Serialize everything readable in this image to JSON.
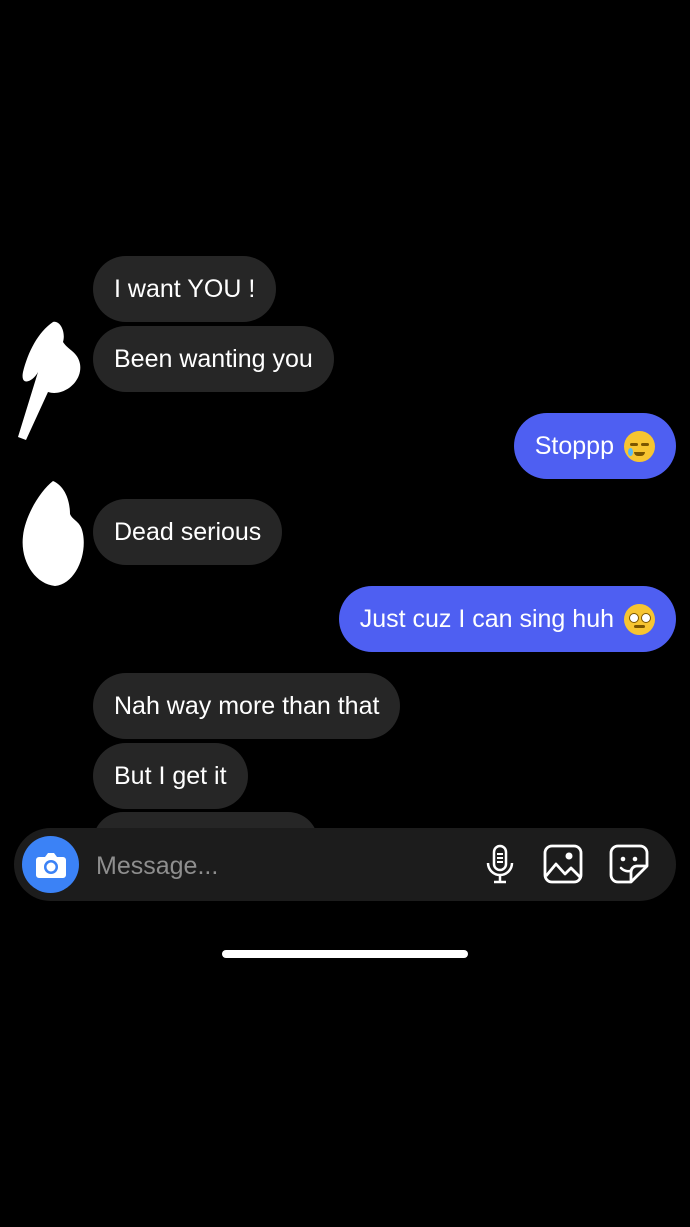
{
  "thread": {
    "messages": [
      {
        "side": "in",
        "text": "I want YOU !"
      },
      {
        "side": "in",
        "text": "Been wanting you"
      },
      {
        "side": "out",
        "text": "Stoppp",
        "emoji": "smiling-face-with-tear"
      },
      {
        "side": "in",
        "text": "Dead serious"
      },
      {
        "side": "out",
        "text": "Just cuz I can sing huh",
        "emoji": "rolling-eyes"
      },
      {
        "side": "in",
        "text": "Nah way more than that"
      },
      {
        "side": "in",
        "text": "But I get it"
      }
    ]
  },
  "composer": {
    "placeholder": "Message...",
    "icons": [
      "camera-icon",
      "microphone-icon",
      "gallery-icon",
      "sticker-icon"
    ]
  },
  "colors": {
    "background": "#000000",
    "incoming_bubble": "#262626",
    "outgoing_bubble": "#4e5ff2",
    "camera_button": "#3b82f6",
    "composer": "#1c1c1c"
  }
}
